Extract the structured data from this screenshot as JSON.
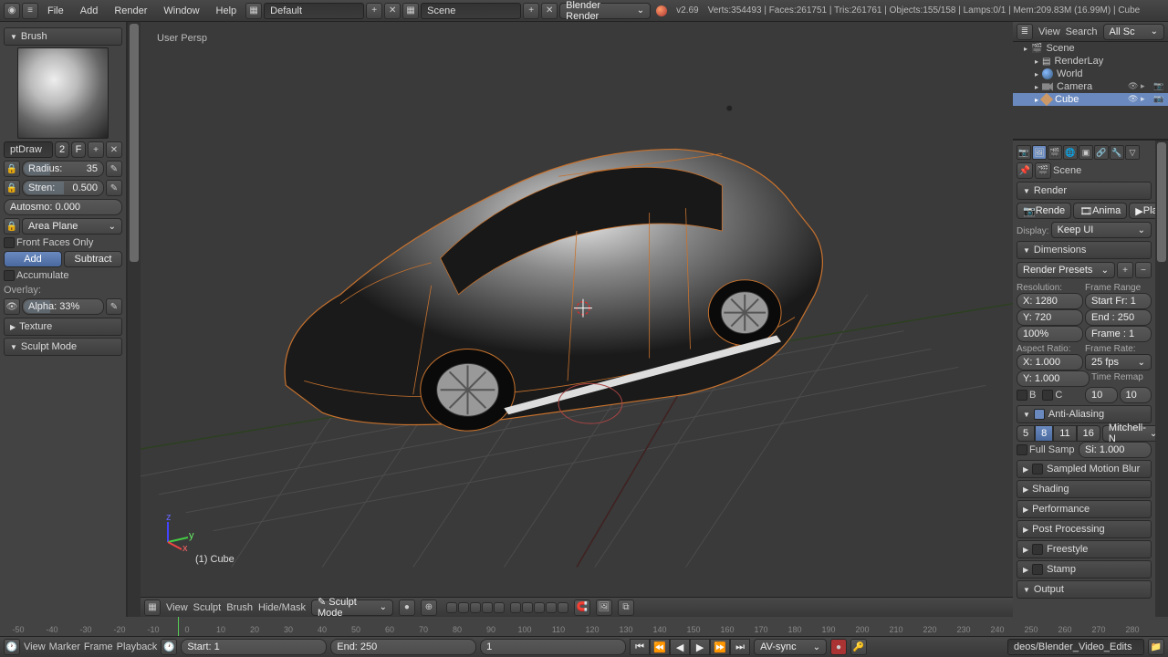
{
  "top": {
    "menus": [
      "File",
      "Add",
      "Render",
      "Window",
      "Help"
    ],
    "layout": "Default",
    "scene": "Scene",
    "engine": "Blender Render",
    "version": "v2.69",
    "stats": "Verts:354493 | Faces:261751 | Tris:261761 | Objects:155/158 | Lamps:0/1 | Mem:209.83M (16.99M) | Cube"
  },
  "brush": {
    "title": "Brush",
    "name": "ptDraw",
    "users": "2",
    "fake": "F",
    "radius_label": "Radius:",
    "radius": "35",
    "strength_label": "Stren:",
    "strength": "0.500",
    "autosmooth": "Autosmo: 0.000",
    "plane": "Area Plane",
    "front_faces": "Front Faces Only",
    "add": "Add",
    "subtract": "Subtract",
    "accumulate": "Accumulate",
    "overlay": "Overlay:",
    "alpha": "Alpha: 33%",
    "texture": "Texture",
    "sculpt_mode": "Sculpt Mode"
  },
  "viewport": {
    "persp": "User Persp",
    "object": "(1) Cube",
    "header": {
      "view": "View",
      "sculpt": "Sculpt",
      "brush": "Brush",
      "hide": "Hide/Mask",
      "mode": "Sculpt Mode"
    }
  },
  "outliner": {
    "header": {
      "view": "View",
      "search": "Search",
      "all": "All Sc"
    },
    "items": [
      {
        "indent": 1,
        "label": "Scene",
        "icon": "scene"
      },
      {
        "indent": 2,
        "label": "RenderLay",
        "icon": "render"
      },
      {
        "indent": 2,
        "label": "World",
        "icon": "world"
      },
      {
        "indent": 2,
        "label": "Camera",
        "icon": "camera",
        "ctrls": true
      },
      {
        "indent": 2,
        "label": "Cube",
        "icon": "mesh",
        "ctrls": true,
        "sel": true
      }
    ]
  },
  "props": {
    "context": "Scene",
    "render": {
      "title": "Render",
      "render_btn": "Rende",
      "anim_btn": "Anima",
      "play_btn": "Play",
      "display": "Display:",
      "display_mode": "Keep UI"
    },
    "dimensions": {
      "title": "Dimensions",
      "presets": "Render Presets",
      "resolution": "Resolution:",
      "x": "X: 1280",
      "y": "Y: 720",
      "pct": "100%",
      "aspect": "Aspect Ratio:",
      "ax": "X: 1.000",
      "ay": "Y: 1.000",
      "border": "B",
      "crop": "C",
      "frame_range": "Frame Range",
      "start": "Start Fr: 1",
      "end": "End : 250",
      "step": "Frame : 1",
      "frame_rate": "Frame Rate:",
      "fps": "25 fps",
      "remap": "Time Remap",
      "old": "10",
      "new": "10"
    },
    "aa": {
      "title": "Anti-Aliasing",
      "s5": "5",
      "s8": "8",
      "s11": "11",
      "s16": "16",
      "filter": "Mitchell-N",
      "full": "Full Samp",
      "size": "Si: 1.000"
    },
    "panels": [
      "Sampled Motion Blur",
      "Shading",
      "Performance",
      "Post Processing",
      "Freestyle",
      "Stamp",
      "Output"
    ]
  },
  "timeline": {
    "header": {
      "view": "View",
      "marker": "Marker",
      "frame": "Frame",
      "playback": "Playback"
    },
    "start": "Start: 1",
    "end": "End: 250",
    "current": "1",
    "sync": "AV-sync",
    "path": "deos/Blender_Video_Edits",
    "ticks": [
      "-50",
      "-40",
      "-30",
      "-20",
      "-10",
      "0",
      "10",
      "20",
      "30",
      "40",
      "50",
      "60",
      "70",
      "80",
      "90",
      "100",
      "110",
      "120",
      "130",
      "140",
      "150",
      "160",
      "170",
      "180",
      "190",
      "200",
      "210",
      "220",
      "230",
      "240",
      "250",
      "260",
      "270",
      "280"
    ]
  }
}
